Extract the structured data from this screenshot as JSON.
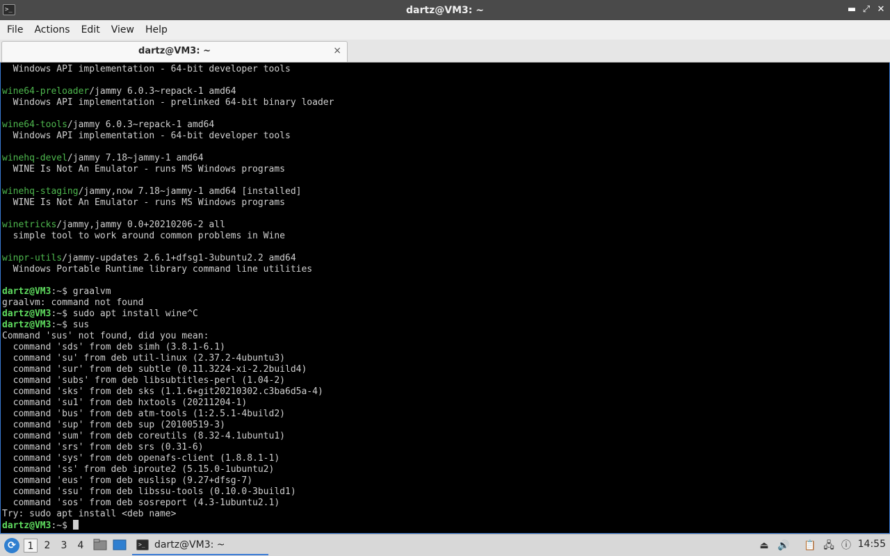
{
  "window": {
    "title": "dartz@VM3: ~",
    "controls": [
      "minimize",
      "maximize",
      "close"
    ]
  },
  "menu": {
    "items": [
      "File",
      "Actions",
      "Edit",
      "View",
      "Help"
    ]
  },
  "tab": {
    "label": "dartz@VM3: ~",
    "close_glyph": "×"
  },
  "terminal": {
    "prompt_user": "dartz@VM3",
    "prompt_path": ":~$ ",
    "lines": [
      {
        "pkg": "",
        "text": "  Windows API implementation - 64-bit developer tools"
      },
      {
        "pkg": "",
        "text": ""
      },
      {
        "pkg": "wine64-preloader",
        "text": "/jammy 6.0.3~repack-1 amd64"
      },
      {
        "pkg": "",
        "text": "  Windows API implementation - prelinked 64-bit binary loader"
      },
      {
        "pkg": "",
        "text": ""
      },
      {
        "pkg": "wine64-tools",
        "text": "/jammy 6.0.3~repack-1 amd64"
      },
      {
        "pkg": "",
        "text": "  Windows API implementation - 64-bit developer tools"
      },
      {
        "pkg": "",
        "text": ""
      },
      {
        "pkg": "winehq-devel",
        "text": "/jammy 7.18~jammy-1 amd64"
      },
      {
        "pkg": "",
        "text": "  WINE Is Not An Emulator - runs MS Windows programs"
      },
      {
        "pkg": "",
        "text": ""
      },
      {
        "pkg": "winehq-staging",
        "text": "/jammy,now 7.18~jammy-1 amd64 [installed]"
      },
      {
        "pkg": "",
        "text": "  WINE Is Not An Emulator - runs MS Windows programs"
      },
      {
        "pkg": "",
        "text": ""
      },
      {
        "pkg": "winetricks",
        "text": "/jammy,jammy 0.0+20210206-2 all"
      },
      {
        "pkg": "",
        "text": "  simple tool to work around common problems in Wine"
      },
      {
        "pkg": "",
        "text": ""
      },
      {
        "pkg": "winpr-utils",
        "text": "/jammy-updates 2.6.1+dfsg1-3ubuntu2.2 amd64"
      },
      {
        "pkg": "",
        "text": "  Windows Portable Runtime library command line utilities"
      },
      {
        "pkg": "",
        "text": ""
      },
      {
        "prompt": true,
        "text": "graalvm"
      },
      {
        "pkg": "",
        "text": "graalvm: command not found"
      },
      {
        "prompt": true,
        "text": "sudo apt install wine^C"
      },
      {
        "prompt": true,
        "text": "sus"
      },
      {
        "pkg": "",
        "text": "Command 'sus' not found, did you mean:"
      },
      {
        "pkg": "",
        "text": "  command 'sds' from deb simh (3.8.1-6.1)"
      },
      {
        "pkg": "",
        "text": "  command 'su' from deb util-linux (2.37.2-4ubuntu3)"
      },
      {
        "pkg": "",
        "text": "  command 'sur' from deb subtle (0.11.3224-xi-2.2build4)"
      },
      {
        "pkg": "",
        "text": "  command 'subs' from deb libsubtitles-perl (1.04-2)"
      },
      {
        "pkg": "",
        "text": "  command 'sks' from deb sks (1.1.6+git20210302.c3ba6d5a-4)"
      },
      {
        "pkg": "",
        "text": "  command 'su1' from deb hxtools (20211204-1)"
      },
      {
        "pkg": "",
        "text": "  command 'bus' from deb atm-tools (1:2.5.1-4build2)"
      },
      {
        "pkg": "",
        "text": "  command 'sup' from deb sup (20100519-3)"
      },
      {
        "pkg": "",
        "text": "  command 'sum' from deb coreutils (8.32-4.1ubuntu1)"
      },
      {
        "pkg": "",
        "text": "  command 'srs' from deb srs (0.31-6)"
      },
      {
        "pkg": "",
        "text": "  command 'sys' from deb openafs-client (1.8.8.1-1)"
      },
      {
        "pkg": "",
        "text": "  command 'ss' from deb iproute2 (5.15.0-1ubuntu2)"
      },
      {
        "pkg": "",
        "text": "  command 'eus' from deb euslisp (9.27+dfsg-7)"
      },
      {
        "pkg": "",
        "text": "  command 'ssu' from deb libssu-tools (0.10.0-3build1)"
      },
      {
        "pkg": "",
        "text": "  command 'sos' from deb sosreport (4.3-1ubuntu2.1)"
      },
      {
        "pkg": "",
        "text": "Try: sudo apt install <deb name>"
      },
      {
        "prompt": true,
        "text": "",
        "cursor": true
      }
    ]
  },
  "taskbar": {
    "workspaces": [
      "1",
      "2",
      "3",
      "4"
    ],
    "active_workspace": "1",
    "task_label": "dartz@VM3: ~",
    "clock": "14:55",
    "colors": {
      "accent": "#3a7bd5",
      "prompt": "#5fdc5f",
      "package": "#4eb84e"
    }
  }
}
